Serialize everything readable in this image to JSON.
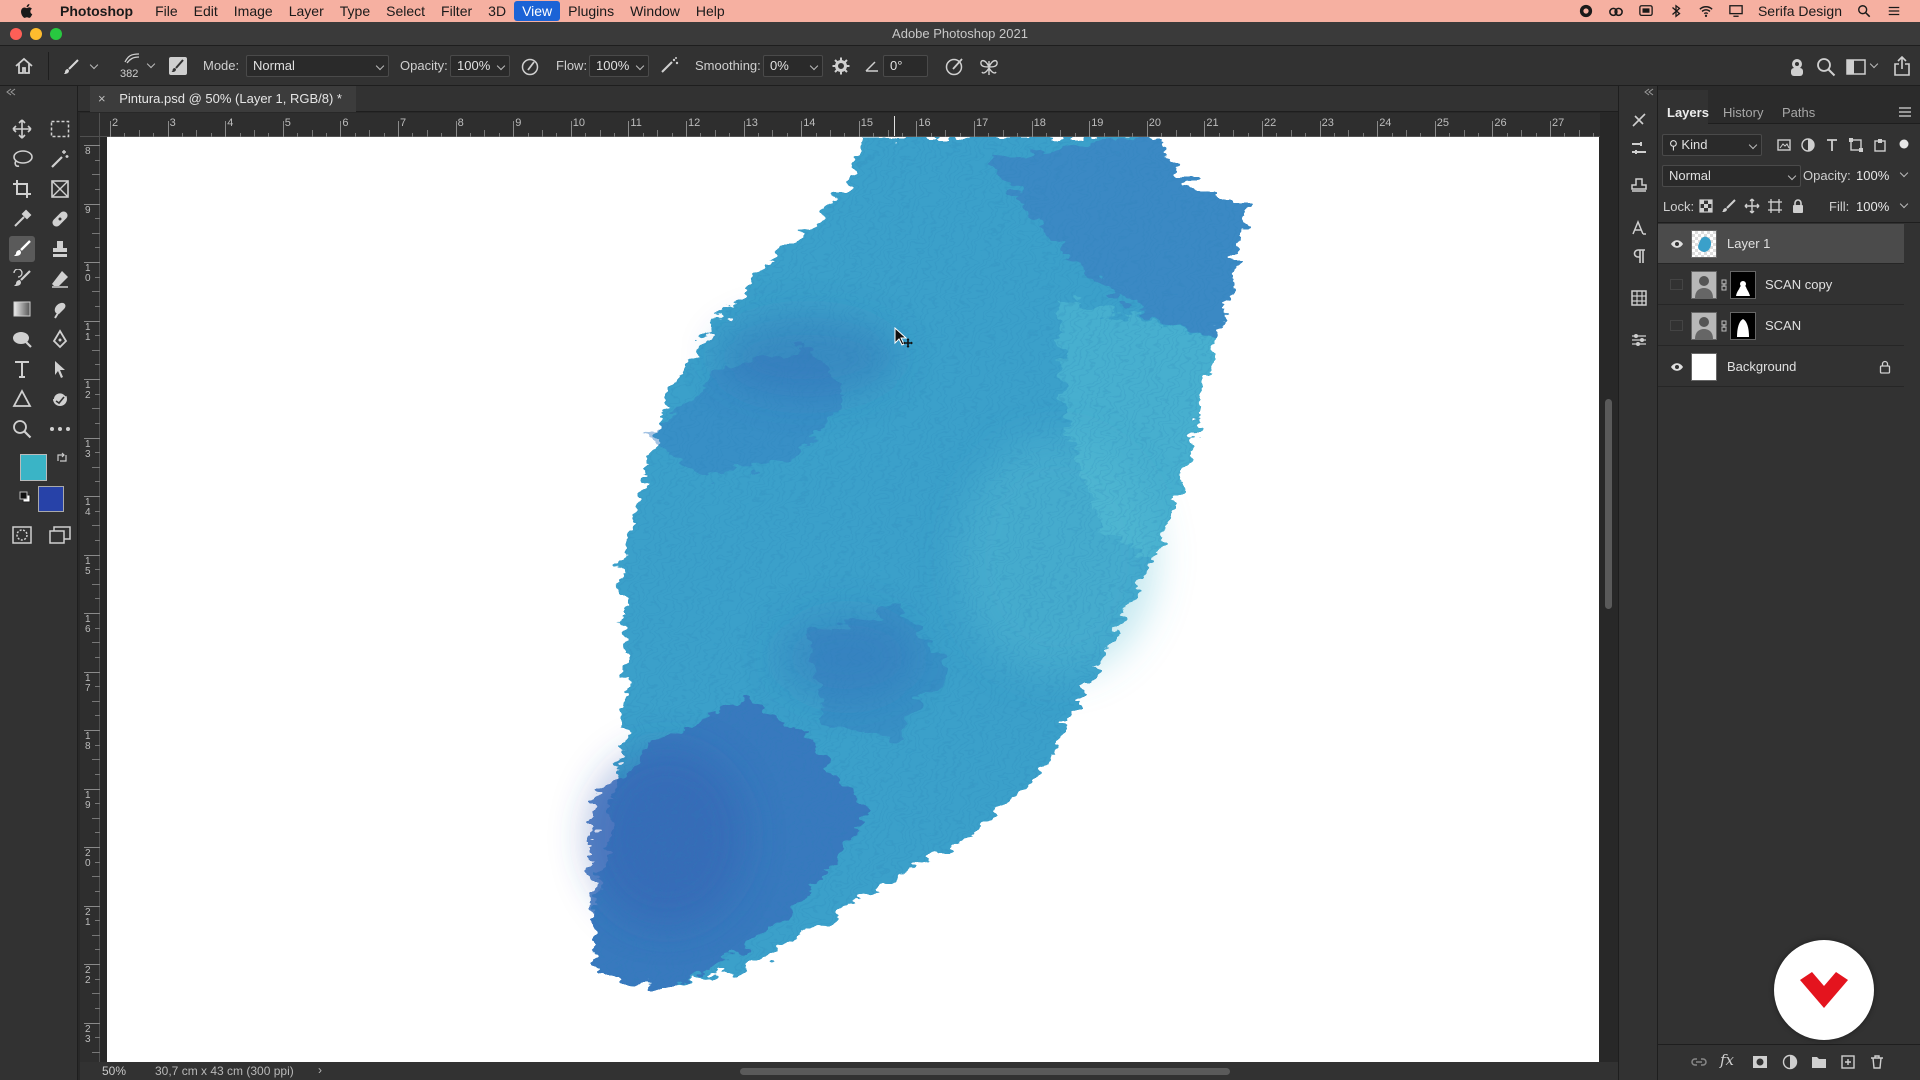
{
  "menubar": {
    "app_name": "Photoshop",
    "items": [
      "File",
      "Edit",
      "Image",
      "Layer",
      "Type",
      "Select",
      "Filter",
      "3D",
      "View",
      "Plugins",
      "Window",
      "Help"
    ],
    "active_item": "View",
    "user_name": "Serifa Design"
  },
  "window": {
    "title": "Adobe Photoshop 2021"
  },
  "options": {
    "brush_size": "382",
    "mode_label": "Mode:",
    "mode_value": "Normal",
    "opacity_label": "Opacity:",
    "opacity_value": "100%",
    "flow_label": "Flow:",
    "flow_value": "100%",
    "smoothing_label": "Smoothing:",
    "smoothing_value": "0%",
    "angle_value": "0°"
  },
  "document": {
    "tab_title": "Pintura.psd @ 50% (Layer 1, RGB/8) *",
    "zoom": "50%",
    "doc_info": "30,7 cm x 43 cm (300 ppi)",
    "hruler_ticks": [
      "2",
      "3",
      "4",
      "5",
      "6",
      "7",
      "8",
      "9",
      "10",
      "11",
      "12",
      "13",
      "14",
      "15",
      "16",
      "17",
      "18",
      "19",
      "20",
      "21",
      "22",
      "23",
      "24",
      "25",
      "26",
      "27"
    ],
    "vruler_ticks": [
      "8",
      "9",
      "1 0",
      "1 1",
      "1 2",
      "1 3",
      "1 4",
      "1 5",
      "1 6",
      "1 7",
      "1 8",
      "1 9",
      "2 0",
      "2 1",
      "2 2",
      "2 3"
    ]
  },
  "colors": {
    "foreground": "#3ab4c6",
    "background": "#2742a8",
    "paint_main": "#3a9fca",
    "paint_dark": "#3468b8",
    "paint_light": "#52b8d0"
  },
  "layers_panel": {
    "tabs": [
      "Layers",
      "History",
      "Paths"
    ],
    "active_tab": "Layers",
    "filter_kind": "Kind",
    "blend_mode": "Normal",
    "opacity_label": "Opacity:",
    "opacity_value": "100%",
    "lock_label": "Lock:",
    "fill_label": "Fill:",
    "fill_value": "100%",
    "layers": [
      {
        "name": "Layer 1",
        "visible": true,
        "selected": true,
        "mask": false,
        "locked": false
      },
      {
        "name": "SCAN copy",
        "visible": false,
        "selected": false,
        "mask": true,
        "locked": false
      },
      {
        "name": "SCAN",
        "visible": false,
        "selected": false,
        "mask": true,
        "locked": false
      },
      {
        "name": "Background",
        "visible": true,
        "selected": false,
        "mask": false,
        "locked": true
      }
    ]
  }
}
